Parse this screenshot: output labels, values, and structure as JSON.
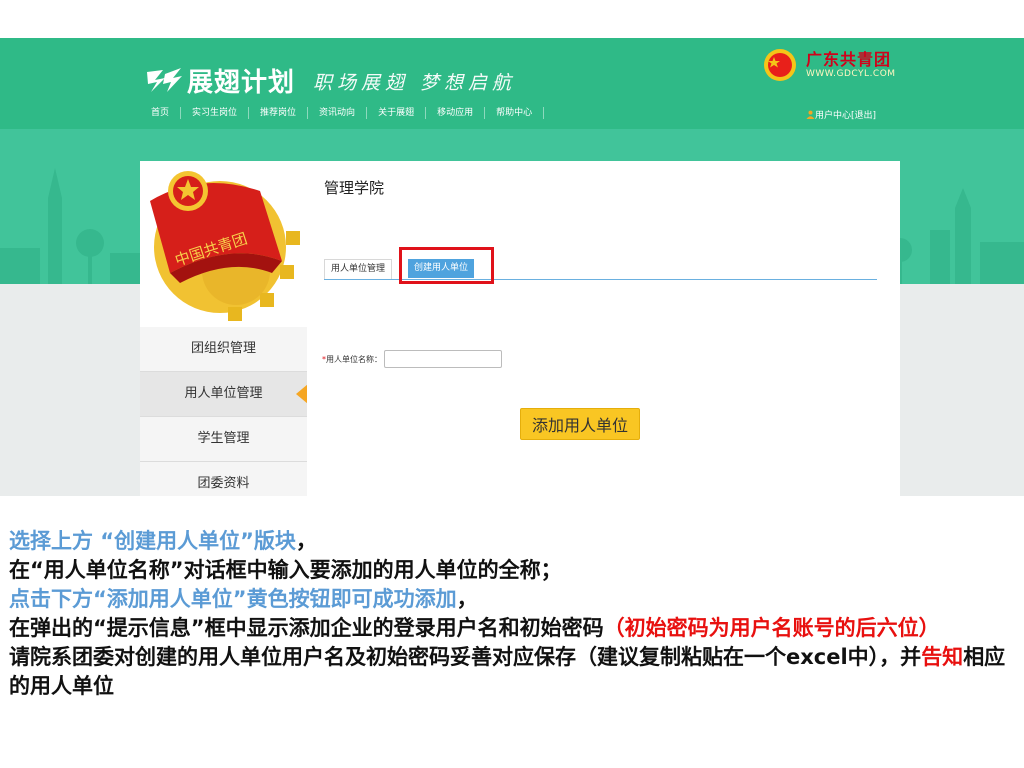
{
  "site": {
    "logo_text": "展翅计划",
    "slogan": "职场展翅 梦想启航",
    "partner_name": "广东共青团",
    "partner_url": "WWW.GDCYL.COM",
    "nav": [
      "首页",
      "实习生岗位",
      "推荐岗位",
      "资讯动向",
      "关于展翅",
      "移动应用",
      "帮助中心",
      ""
    ],
    "user_center": "用户中心",
    "logout": "[退出]"
  },
  "sidebar": {
    "emblem_text": "中国共青团",
    "items": [
      {
        "label": "团组织管理"
      },
      {
        "label": "用人单位管理",
        "active": true
      },
      {
        "label": "学生管理"
      },
      {
        "label": "团委资料"
      }
    ]
  },
  "panel": {
    "title": "管理学院",
    "tabs": [
      {
        "label": "用人单位管理"
      },
      {
        "label": "创建用人单位",
        "active": true
      }
    ],
    "field_required": "*",
    "field_label": "用人单位名称：",
    "field_value": "",
    "add_button": "添加用人单位"
  },
  "colors": {
    "header_green": "#2fba87",
    "band_green": "#41c49a",
    "tab_active": "#4fa3de",
    "button_yellow": "#f9c623",
    "highlight_red": "#e0121a",
    "note_blue": "#5b9bd5",
    "note_red": "#e8100f"
  },
  "notes": {
    "l1_a": "选择上方 “创建用人单位”版块",
    "l1_b": "，",
    "l2": "在“用人单位名称”对话框中输入要添加的用人单位的全称；",
    "l3_a": "点击下方“添加用人单位”黄色按钮即可成功添加",
    "l3_b": "，",
    "l4_a": "在弹出的“提示信息”框中显示添加企业的登录用户名和初始密码",
    "l4_b": "（初始密码为用户名账号的后六位）",
    "l5_a": "请院系团委对创建的用人单位用户名及初始密码妥善对应保存（建议复制粘贴在一个excel中），并",
    "l5_b": "告知",
    "l5_c": "相应的用人单位"
  }
}
